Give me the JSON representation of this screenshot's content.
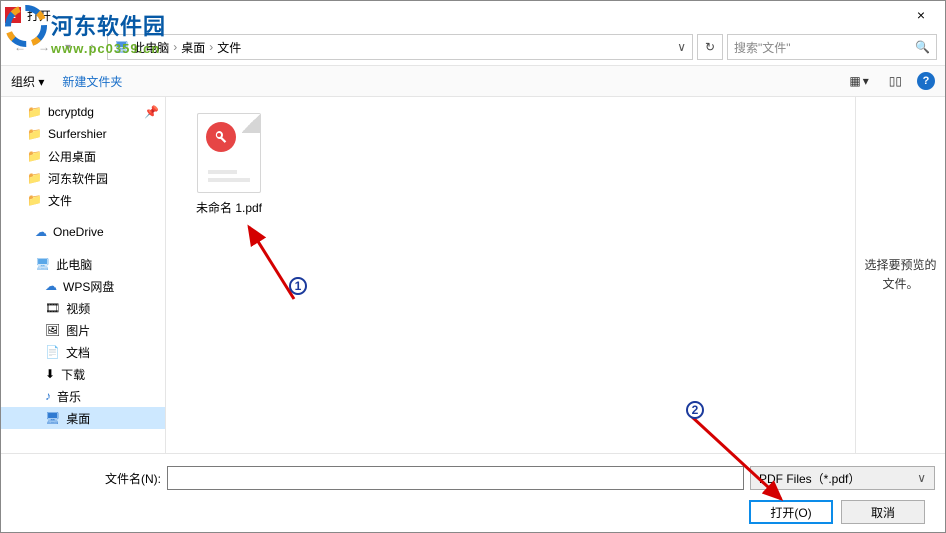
{
  "titlebar": {
    "app_letter": "2",
    "title": "打开",
    "close": "×"
  },
  "nav": {
    "crumbs": [
      "此电脑",
      "桌面",
      "文件"
    ],
    "search_placeholder": "搜索\"文件\""
  },
  "toolbar": {
    "organize": "组织",
    "dd": "▾",
    "newfolder": "新建文件夹",
    "help": "?"
  },
  "sidebar": {
    "items": [
      {
        "icon": "folder",
        "label": "bcryptdg",
        "pin": true
      },
      {
        "icon": "folder",
        "label": "Surfershier"
      },
      {
        "icon": "folder",
        "label": "公用桌面"
      },
      {
        "icon": "folder",
        "label": "河东软件园"
      },
      {
        "icon": "folder",
        "label": "文件"
      },
      {
        "icon": "cloud",
        "label": "OneDrive",
        "top": true
      },
      {
        "icon": "pc",
        "label": "此电脑",
        "top": true
      },
      {
        "icon": "cloud",
        "label": "WPS网盘",
        "lvl": 2
      },
      {
        "icon": "video",
        "label": "视频",
        "lvl": 2
      },
      {
        "icon": "image",
        "label": "图片",
        "lvl": 2
      },
      {
        "icon": "doc",
        "label": "文档",
        "lvl": 2
      },
      {
        "icon": "dl",
        "label": "下载",
        "lvl": 2
      },
      {
        "icon": "music",
        "label": "音乐",
        "lvl": 2
      },
      {
        "icon": "desktop",
        "label": "桌面",
        "lvl": 2,
        "sel": true
      }
    ]
  },
  "file": {
    "name": "未命名 1.pdf"
  },
  "preview": "选择要预览的文件。",
  "footer": {
    "filename_label": "文件名(N):",
    "filename_value": "",
    "filetype": "PDF Files（*.pdf）",
    "open": "打开(O)",
    "cancel": "取消"
  },
  "watermark": {
    "line1": "河东软件园",
    "line2": "www.pc0359.cn"
  },
  "annotations": {
    "n1": "1",
    "n2": "2"
  }
}
